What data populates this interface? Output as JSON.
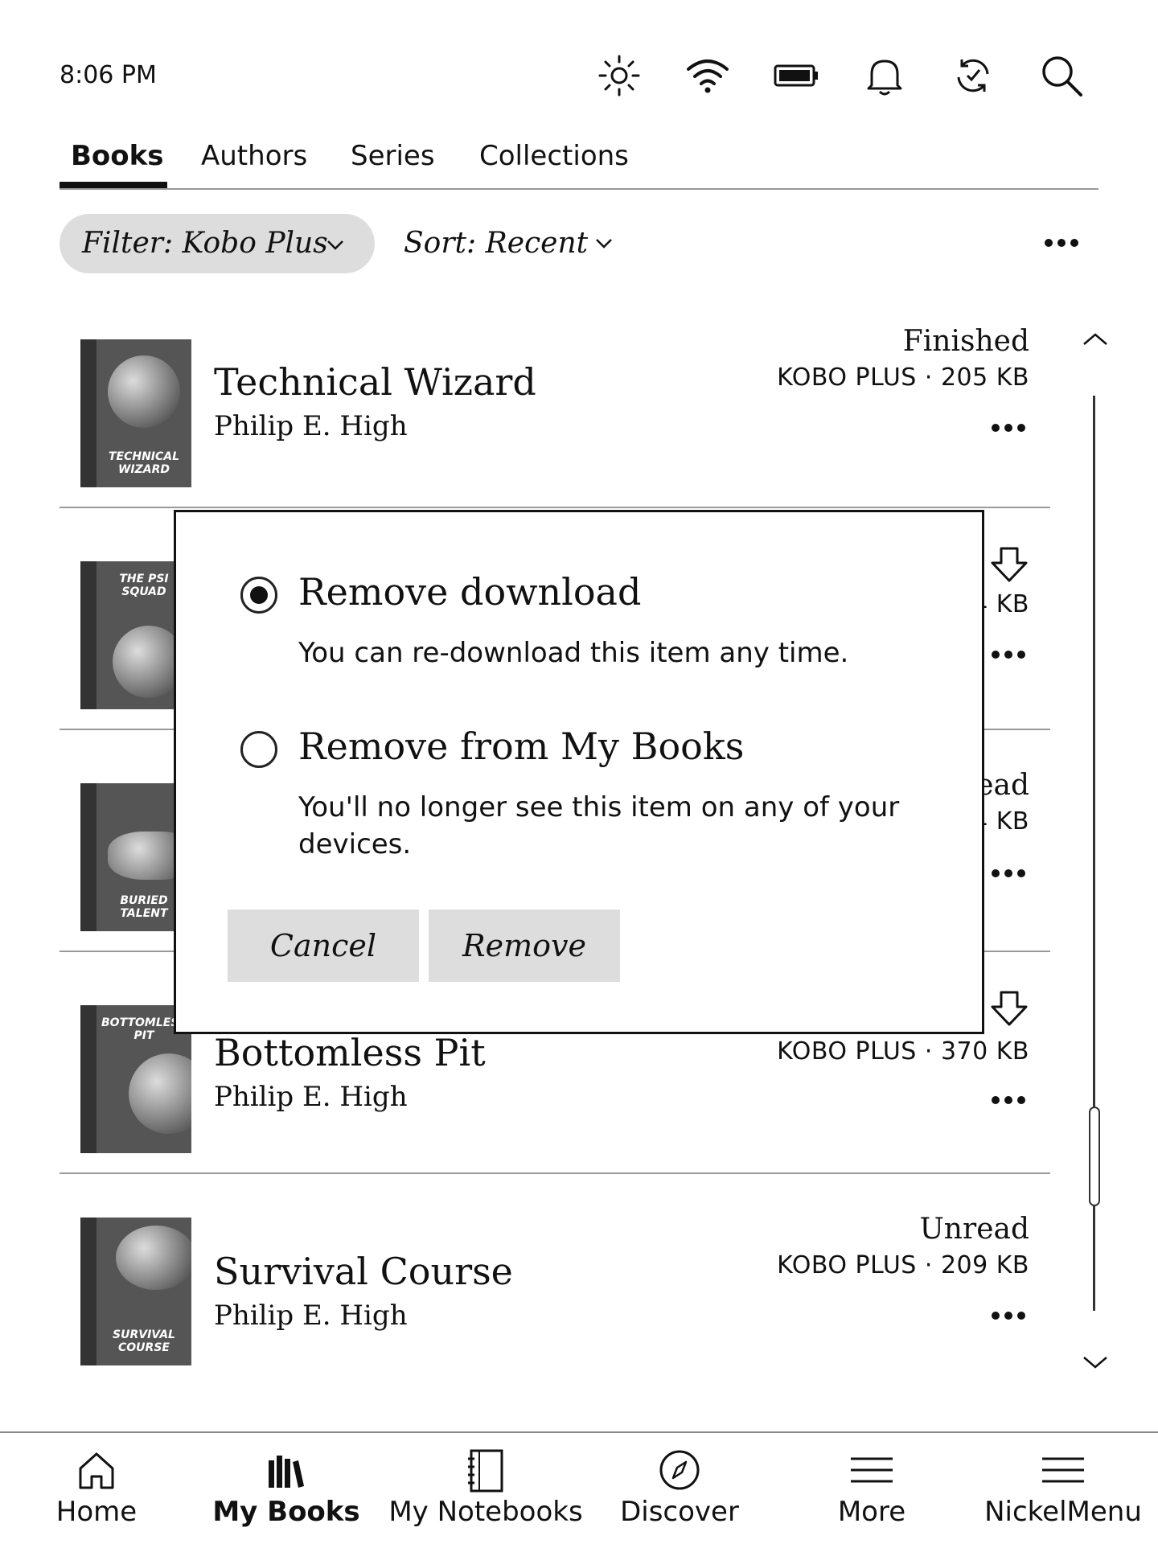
{
  "status_bar": {
    "time": "8:06 PM",
    "icons": [
      "brightness-icon",
      "wifi-icon",
      "battery-icon",
      "notification-bell-icon",
      "sync-icon",
      "search-icon"
    ]
  },
  "tabs": [
    {
      "label": "Books",
      "active": true
    },
    {
      "label": "Authors",
      "active": false
    },
    {
      "label": "Series",
      "active": false
    },
    {
      "label": "Collections",
      "active": false
    }
  ],
  "filter": {
    "label": "Filter: Kobo Plus"
  },
  "sort": {
    "label": "Sort: Recent"
  },
  "books": [
    {
      "title": "Technical Wizard",
      "author": "Philip E. High",
      "status": "Finished",
      "meta": "KOBO PLUS · 205 KB",
      "cover_text": "TECHNICAL WIZARD"
    },
    {
      "title": "",
      "author": "",
      "status": "",
      "meta": "4 KB",
      "cover_text": "THE PSI SQUAD"
    },
    {
      "title": "",
      "author": "",
      "status": "ead",
      "meta": "4 KB",
      "cover_text": "BURIED TALENT"
    },
    {
      "title": "Bottomless Pit",
      "author": "Philip E. High",
      "status": "",
      "meta": "KOBO PLUS · 370 KB",
      "cover_text": "BOTTOMLESS PIT"
    },
    {
      "title": "Survival Course",
      "author": "Philip E. High",
      "status": "Unread",
      "meta": "KOBO PLUS · 209 KB",
      "cover_text": "SURVIVAL COURSE"
    }
  ],
  "dialog": {
    "options": [
      {
        "title": "Remove download",
        "desc": "You can re-download this item any time.",
        "selected": true
      },
      {
        "title": "Remove from My Books",
        "desc": "You'll no longer see this item on any of your devices.",
        "selected": false
      }
    ],
    "cancel_label": "Cancel",
    "remove_label": "Remove"
  },
  "bottom_nav": [
    {
      "label": "Home",
      "icon": "home-icon",
      "active": false
    },
    {
      "label": "My Books",
      "icon": "my-books-icon",
      "active": true
    },
    {
      "label": "My Notebooks",
      "icon": "notebook-icon",
      "active": false
    },
    {
      "label": "Discover",
      "icon": "compass-icon",
      "active": false
    },
    {
      "label": "More",
      "icon": "menu-icon",
      "active": false
    },
    {
      "label": "NickelMenu",
      "icon": "menu-icon",
      "active": false
    }
  ]
}
